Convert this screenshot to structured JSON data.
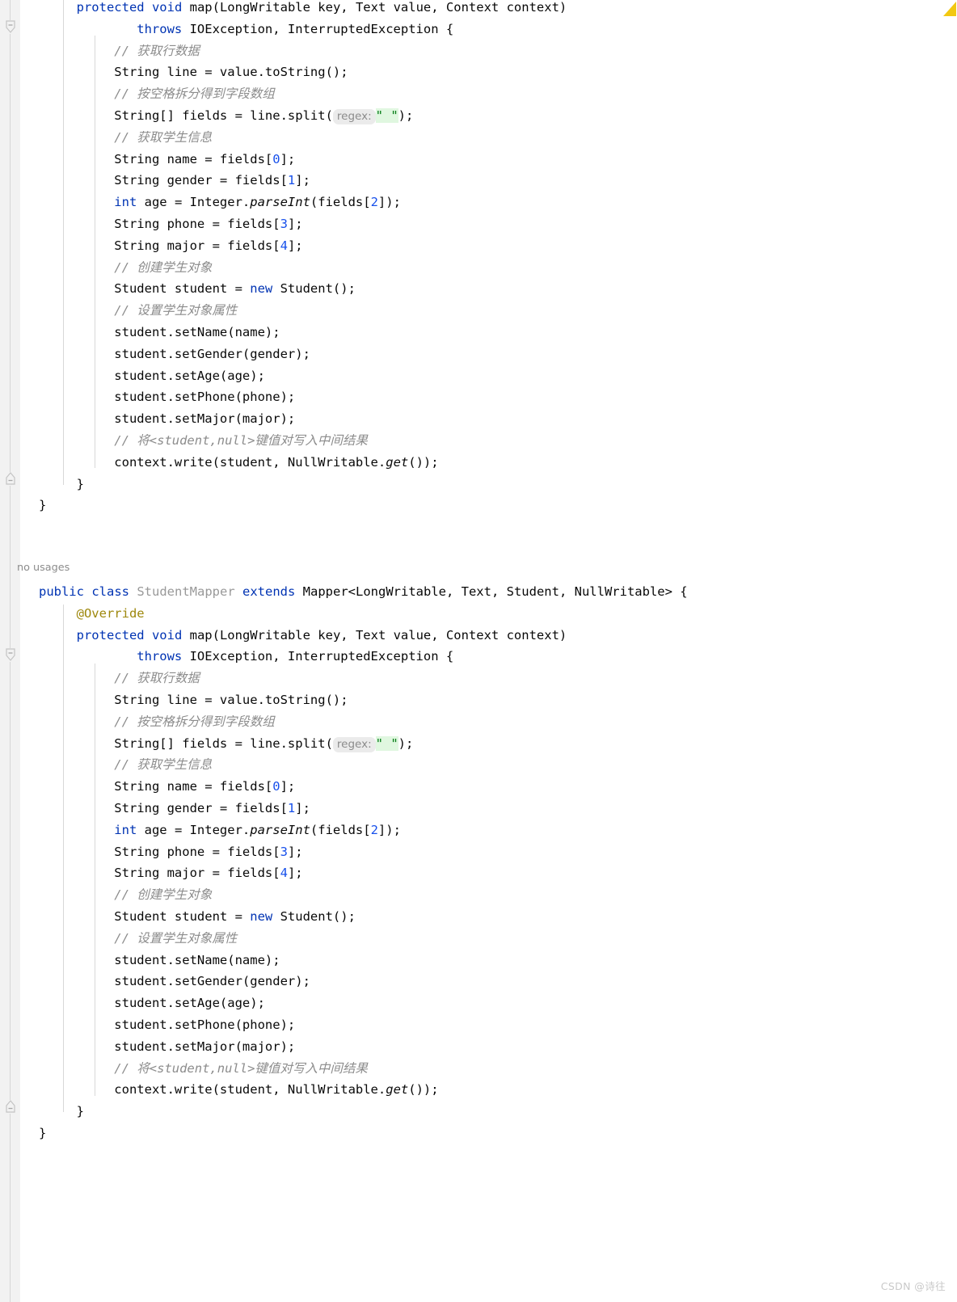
{
  "editor": {
    "app": "IntelliJ IDEA code editor",
    "language": "Java",
    "theme_background": "#ffffff",
    "gutter_background": "#f2f2f2",
    "colors": {
      "keyword": "#0033b3",
      "comment": "#8c8c8c",
      "string": "#067d17",
      "number": "#1750eb",
      "annotation": "#9e880d",
      "unused_identifier": "#999999",
      "default_text": "#080808",
      "parameter_hint_bg": "#ebebeb",
      "warning_marker": "#f2c811"
    }
  },
  "code_vision": {
    "no_usages_label": "no usages"
  },
  "watermark": {
    "text": "CSDN @诗往"
  },
  "gutter": {
    "fold_collapse_icon": "fold-collapse-icon",
    "fold_end_icon": "fold-end-icon"
  },
  "inspection_marker": {
    "name": "warning-triangle-icon",
    "color": "#f2c811"
  },
  "lines": [
    {
      "indent": 8,
      "tokens": [
        {
          "t": "protected",
          "c": "kw"
        },
        {
          "t": " "
        },
        {
          "t": "void",
          "c": "kw"
        },
        {
          "t": " "
        },
        {
          "t": "map",
          "c": "meth"
        },
        {
          "t": "(LongWritable key, Text value, Context context)"
        }
      ]
    },
    {
      "indent": 16,
      "tokens": [
        {
          "t": "throws",
          "c": "kw"
        },
        {
          "t": " IOException, InterruptedException {"
        }
      ]
    },
    {
      "indent": 13,
      "tokens": [
        {
          "t": "// 获取行数据",
          "c": "cmt"
        }
      ]
    },
    {
      "indent": 13,
      "tokens": [
        {
          "t": "String line = value.toString();"
        }
      ]
    },
    {
      "indent": 13,
      "tokens": [
        {
          "t": "// 按空格拆分得到字段数组",
          "c": "cmt"
        }
      ]
    },
    {
      "indent": 13,
      "tokens": [
        {
          "t": "String[] fields = line.split("
        },
        {
          "t": "regex:",
          "c": "hint"
        },
        {
          "t": "\" \"",
          "c": "str strhl"
        },
        {
          "t": ");"
        }
      ]
    },
    {
      "indent": 13,
      "tokens": [
        {
          "t": "// 获取学生信息",
          "c": "cmt"
        }
      ]
    },
    {
      "indent": 13,
      "tokens": [
        {
          "t": "String name = fields["
        },
        {
          "t": "0",
          "c": "num"
        },
        {
          "t": "];"
        }
      ]
    },
    {
      "indent": 13,
      "tokens": [
        {
          "t": "String gender = fields["
        },
        {
          "t": "1",
          "c": "num"
        },
        {
          "t": "];"
        }
      ]
    },
    {
      "indent": 13,
      "tokens": [
        {
          "t": "int",
          "c": "kw"
        },
        {
          "t": " age = Integer."
        },
        {
          "t": "parseInt",
          "c": "ital"
        },
        {
          "t": "(fields["
        },
        {
          "t": "2",
          "c": "num"
        },
        {
          "t": "]);"
        }
      ]
    },
    {
      "indent": 13,
      "tokens": [
        {
          "t": "String phone = fields["
        },
        {
          "t": "3",
          "c": "num"
        },
        {
          "t": "];"
        }
      ]
    },
    {
      "indent": 13,
      "tokens": [
        {
          "t": "String major = fields["
        },
        {
          "t": "4",
          "c": "num"
        },
        {
          "t": "];"
        }
      ]
    },
    {
      "indent": 13,
      "tokens": [
        {
          "t": "// 创建学生对象",
          "c": "cmt"
        }
      ]
    },
    {
      "indent": 13,
      "tokens": [
        {
          "t": "Student student = "
        },
        {
          "t": "new",
          "c": "kw"
        },
        {
          "t": " Student();"
        }
      ]
    },
    {
      "indent": 13,
      "tokens": [
        {
          "t": "// 设置学生对象属性",
          "c": "cmt"
        }
      ]
    },
    {
      "indent": 13,
      "tokens": [
        {
          "t": "student.setName(name);"
        }
      ]
    },
    {
      "indent": 13,
      "tokens": [
        {
          "t": "student.setGender(gender);"
        }
      ]
    },
    {
      "indent": 13,
      "tokens": [
        {
          "t": "student.setAge(age);"
        }
      ]
    },
    {
      "indent": 13,
      "tokens": [
        {
          "t": "student.setPhone(phone);"
        }
      ]
    },
    {
      "indent": 13,
      "tokens": [
        {
          "t": "student.setMajor(major);"
        }
      ]
    },
    {
      "indent": 13,
      "tokens": [
        {
          "t": "// 将<student,null>键值对写入中间结果",
          "c": "cmt"
        }
      ]
    },
    {
      "indent": 13,
      "tokens": [
        {
          "t": "context.write(student, NullWritable."
        },
        {
          "t": "get",
          "c": "ital"
        },
        {
          "t": "());"
        }
      ]
    },
    {
      "indent": 8,
      "tokens": [
        {
          "t": "}"
        }
      ]
    },
    {
      "indent": 3,
      "tokens": [
        {
          "t": "}"
        }
      ]
    }
  ],
  "block2": {
    "header_lines": [
      {
        "indent": 3,
        "tokens": [
          {
            "t": "public",
            "c": "kw"
          },
          {
            "t": " "
          },
          {
            "t": "class",
            "c": "kw"
          },
          {
            "t": " "
          },
          {
            "t": "StudentMapper",
            "c": "dim"
          },
          {
            "t": " "
          },
          {
            "t": "extends",
            "c": "kw"
          },
          {
            "t": " Mapper<LongWritable, Text, Student, NullWritable> {"
          }
        ]
      },
      {
        "indent": 8,
        "tokens": [
          {
            "t": "@Override",
            "c": "anno"
          }
        ]
      }
    ]
  }
}
